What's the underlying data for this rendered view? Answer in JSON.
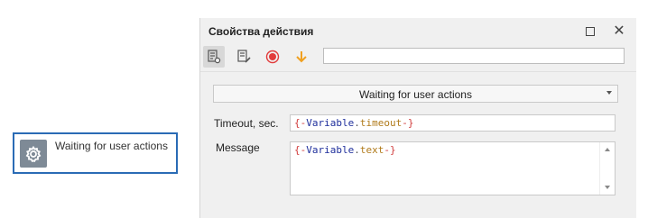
{
  "node": {
    "label": "Waiting for user actions",
    "icon": "gear-icon"
  },
  "panel": {
    "title": "Свойства действия",
    "window_buttons": [
      "restore-icon",
      "close-icon"
    ],
    "close_glyph": "✕",
    "toolbar": {
      "buttons": [
        "properties-settings-icon",
        "edit-note-icon",
        "record-icon",
        "download-arrow-icon"
      ],
      "input_value": ""
    },
    "action_select": {
      "value": "Waiting for user actions"
    },
    "timeout": {
      "label": "Timeout, sec.",
      "value": "{-Variable.timeout-}",
      "parts": {
        "open": "{-",
        "var": "Variable",
        "dot": ".",
        "prop": "timeout",
        "close": "-}"
      }
    },
    "message": {
      "label": "Message",
      "value": "{-Variable.text-}",
      "parts": {
        "open": "{-",
        "var": "Variable",
        "dot": ".",
        "prop": "text",
        "close": "-}"
      }
    }
  },
  "colors": {
    "node_border": "#2a6bb5",
    "node_icon_bg": "#7e8a96",
    "record": "#e23b3b",
    "arrow": "#f0a020",
    "token_brace": "#d13b3b",
    "token_var": "#1f2f9c",
    "token_prop": "#b07a1a"
  }
}
